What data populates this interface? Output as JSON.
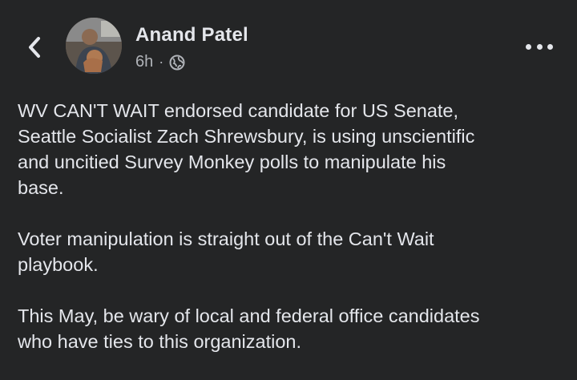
{
  "post": {
    "author": "Anand Patel",
    "timestamp": "6h",
    "separator": "·",
    "privacy_icon": "globe-icon",
    "paragraphs": [
      "WV CAN'T WAIT endorsed candidate for US Senate,\nSeattle Socialist Zach Shrewsbury, is using unscientific\nand uncitied Survey Monkey polls to manipulate his\nbase.",
      "Voter manipulation is straight out of the Can't Wait\nplaybook.",
      "This May, be wary of local and federal office candidates\nwho have ties to this organization."
    ]
  },
  "header": {
    "back_icon": "chevron-left-icon",
    "more_icon": "more-options-icon"
  },
  "colors": {
    "background": "#242526",
    "primary_text": "#e4e6eb",
    "secondary_text": "#b0b3b8"
  }
}
